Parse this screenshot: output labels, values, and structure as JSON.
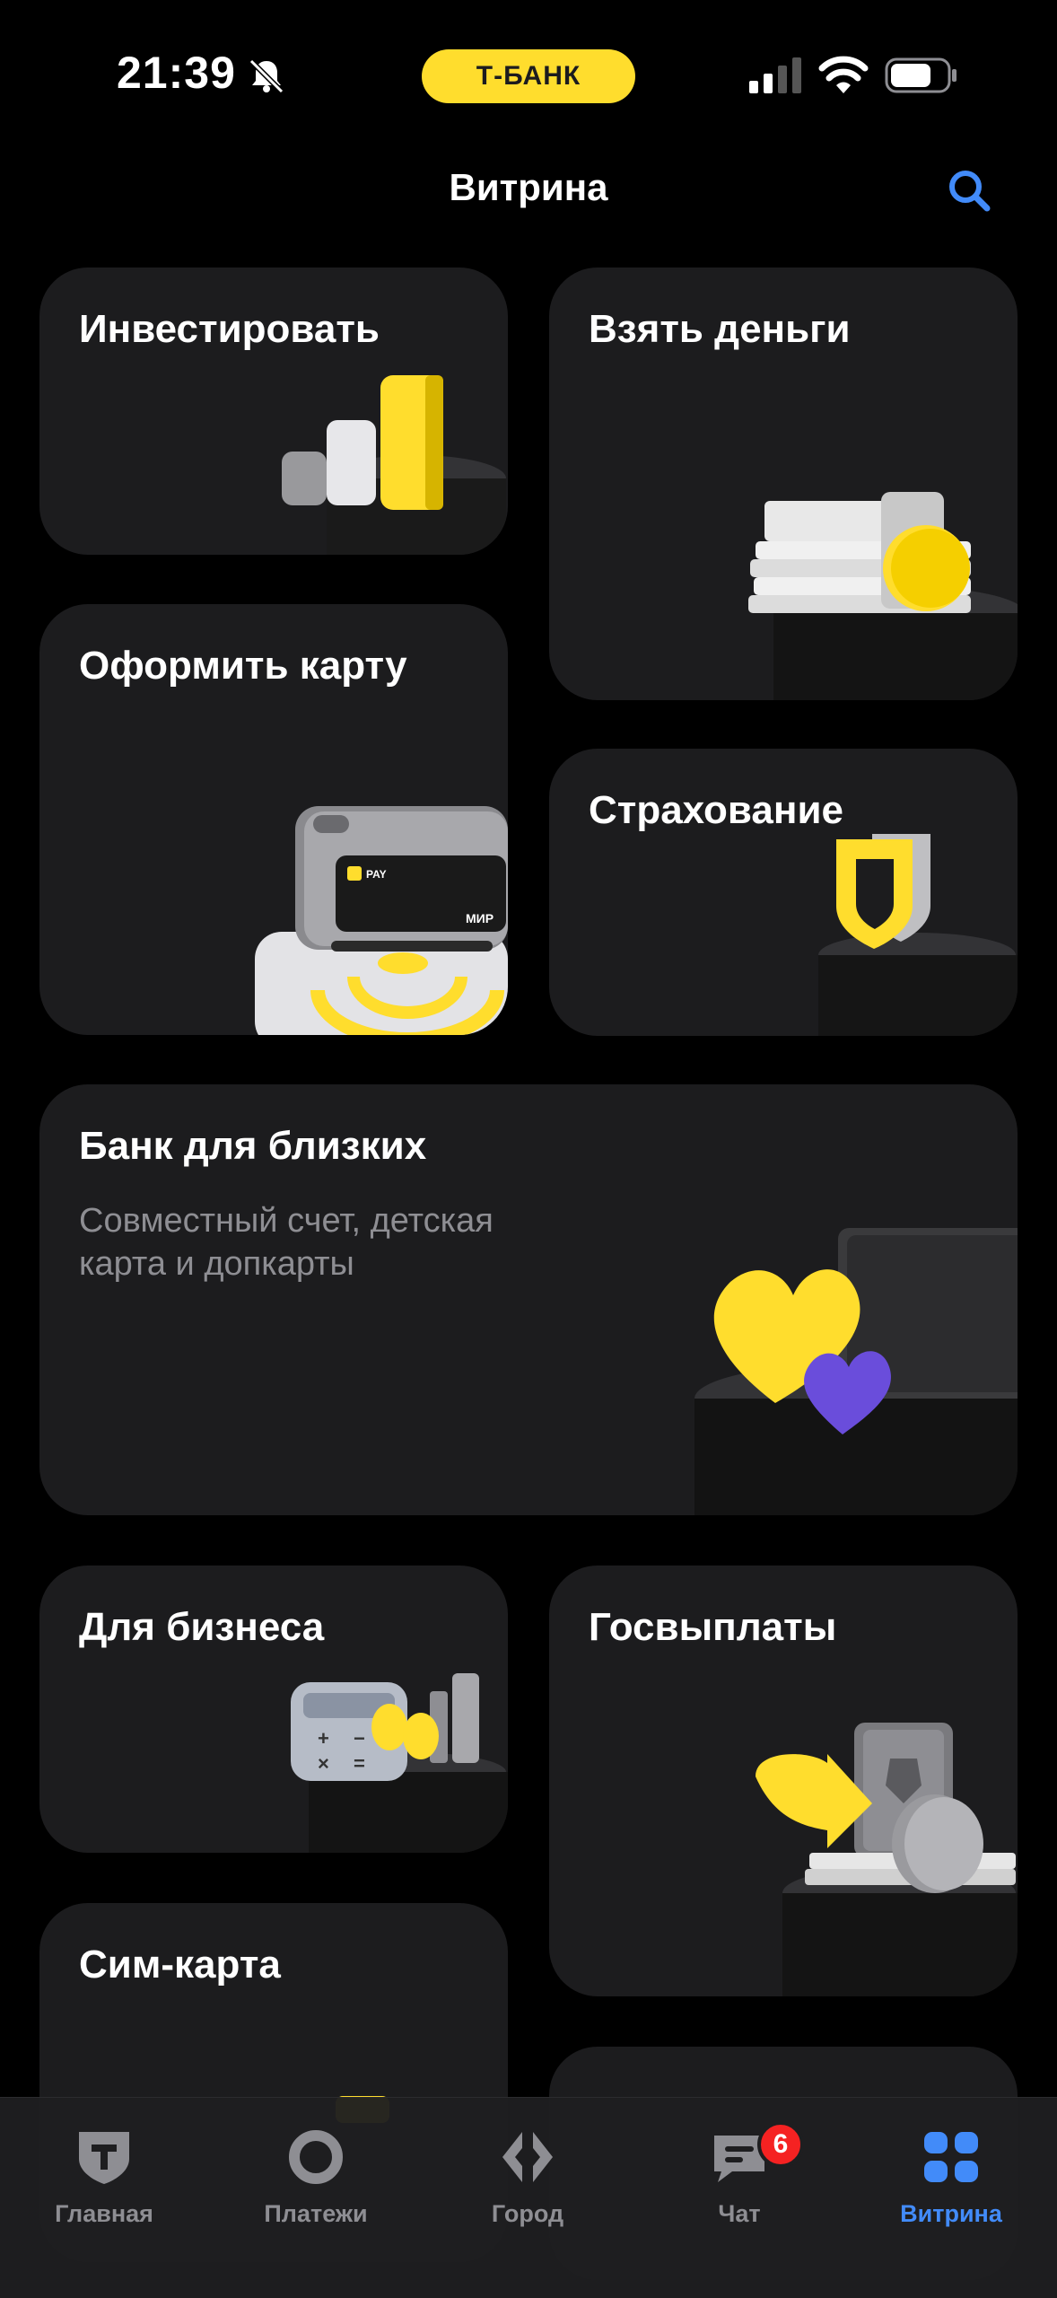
{
  "status_bar": {
    "time": "21:39",
    "bank_label": "Т-БАНК",
    "icons": [
      "bell-off-icon",
      "signal-icon",
      "wifi-icon",
      "battery-icon"
    ]
  },
  "header": {
    "title": "Витрина",
    "search_icon": "search-icon"
  },
  "cards": {
    "invest": {
      "title": "Инвестировать"
    },
    "loan": {
      "title": "Взять деньги"
    },
    "card": {
      "title": "Оформить карту",
      "card_brand": "МИР",
      "pay_label": "PAY"
    },
    "insurance": {
      "title": "Страхование"
    },
    "family": {
      "title": "Банк для близких",
      "subtitle_line1": "Совместный счет, детская",
      "subtitle_line2": "карта и допкарты"
    },
    "business": {
      "title": "Для бизнеса"
    },
    "gov": {
      "title": "Госвыплаты"
    },
    "sim": {
      "title": "Сим-карта"
    }
  },
  "tabbar": {
    "tabs": [
      {
        "label": "Главная",
        "icon": "tbank-shield-icon"
      },
      {
        "label": "Платежи",
        "icon": "payments-circle-icon"
      },
      {
        "label": "Город",
        "icon": "city-diamond-icon"
      },
      {
        "label": "Чат",
        "icon": "chat-icon",
        "badge": "6"
      },
      {
        "label": "Витрина",
        "icon": "showcase-grid-icon",
        "active": true
      }
    ]
  },
  "colors": {
    "accent_yellow": "#ffdd2d",
    "active_blue": "#428bf9",
    "badge_red": "#f52222",
    "card_bg": "#1c1c1e"
  }
}
